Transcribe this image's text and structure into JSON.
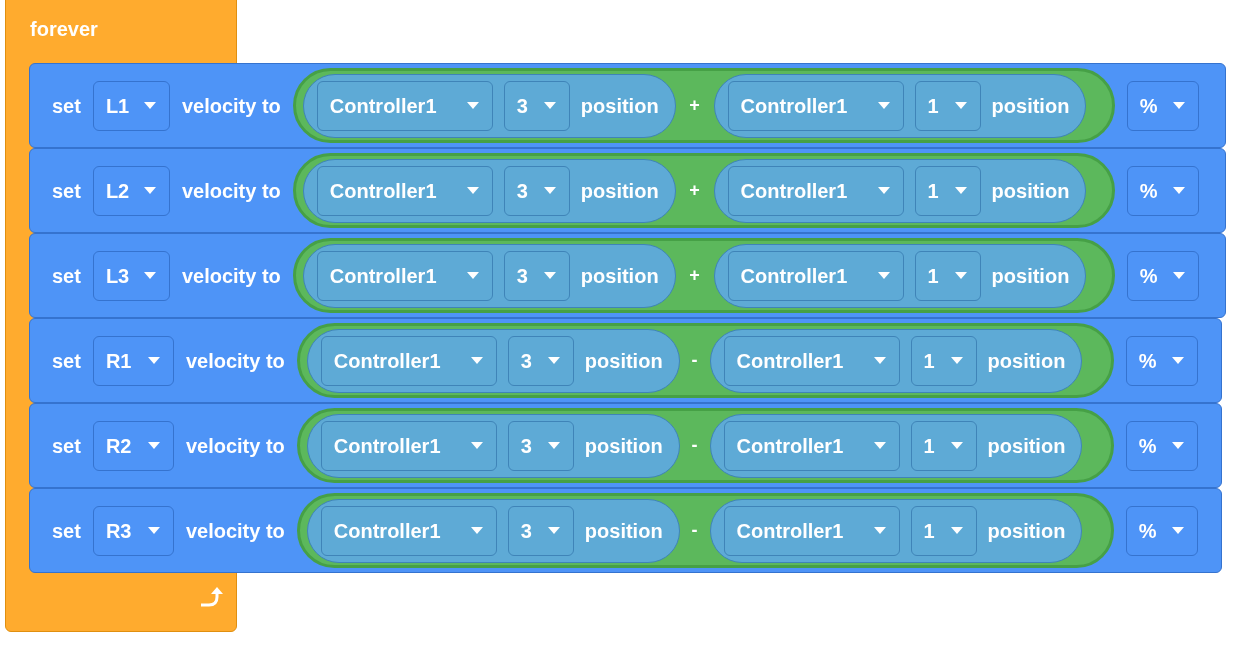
{
  "loop": {
    "label": "forever"
  },
  "rows": [
    {
      "verb": "set",
      "motor": "L1",
      "text": "velocity to",
      "left": {
        "device": "Controller1",
        "axis": "3",
        "label": "position"
      },
      "operator": "+",
      "right": {
        "device": "Controller1",
        "axis": "1",
        "label": "position"
      },
      "unit": "%"
    },
    {
      "verb": "set",
      "motor": "L2",
      "text": "velocity to",
      "left": {
        "device": "Controller1",
        "axis": "3",
        "label": "position"
      },
      "operator": "+",
      "right": {
        "device": "Controller1",
        "axis": "1",
        "label": "position"
      },
      "unit": "%"
    },
    {
      "verb": "set",
      "motor": "L3",
      "text": "velocity to",
      "left": {
        "device": "Controller1",
        "axis": "3",
        "label": "position"
      },
      "operator": "+",
      "right": {
        "device": "Controller1",
        "axis": "1",
        "label": "position"
      },
      "unit": "%"
    },
    {
      "verb": "set",
      "motor": "R1",
      "text": "velocity to",
      "left": {
        "device": "Controller1",
        "axis": "3",
        "label": "position"
      },
      "operator": "-",
      "right": {
        "device": "Controller1",
        "axis": "1",
        "label": "position"
      },
      "unit": "%"
    },
    {
      "verb": "set",
      "motor": "R2",
      "text": "velocity to",
      "left": {
        "device": "Controller1",
        "axis": "3",
        "label": "position"
      },
      "operator": "-",
      "right": {
        "device": "Controller1",
        "axis": "1",
        "label": "position"
      },
      "unit": "%"
    },
    {
      "verb": "set",
      "motor": "R3",
      "text": "velocity to",
      "left": {
        "device": "Controller1",
        "axis": "3",
        "label": "position"
      },
      "operator": "-",
      "right": {
        "device": "Controller1",
        "axis": "1",
        "label": "position"
      },
      "unit": "%"
    }
  ]
}
